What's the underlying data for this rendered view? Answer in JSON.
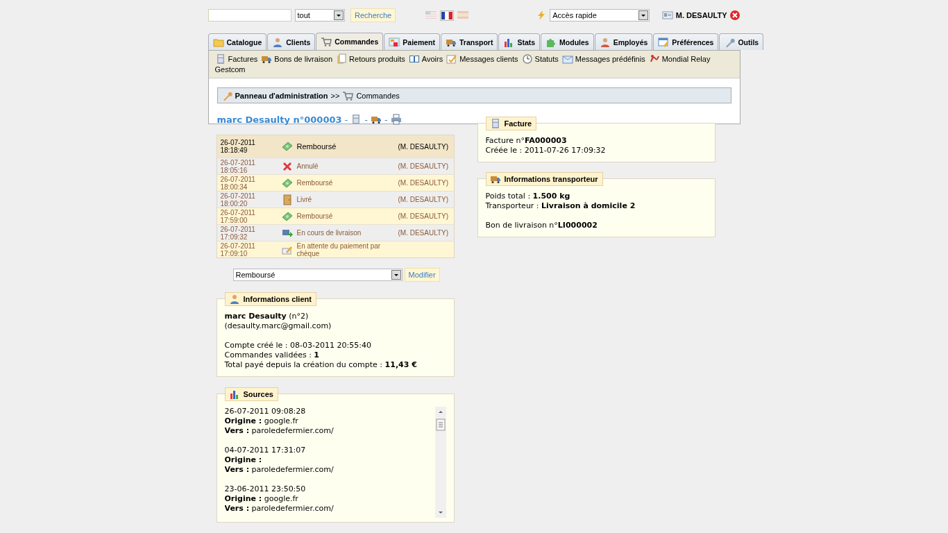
{
  "topbar": {
    "filter": {
      "value": "tout"
    },
    "search_button": "Recherche",
    "languages": [
      {
        "selected": false
      },
      {
        "selected": true
      },
      {
        "selected": false
      }
    ],
    "quick_access": {
      "value": "Accès rapide"
    },
    "user": "M. DESAULTY"
  },
  "tabs": [
    {
      "label": "Catalogue",
      "selected": false
    },
    {
      "label": "Clients",
      "selected": false
    },
    {
      "label": "Commandes",
      "selected": true
    },
    {
      "label": "Paiement",
      "selected": false
    },
    {
      "label": "Transport",
      "selected": false
    },
    {
      "label": "Stats",
      "selected": false
    },
    {
      "label": "Modules",
      "selected": false
    },
    {
      "label": "Employés",
      "selected": false
    },
    {
      "label": "Préférences",
      "selected": false
    },
    {
      "label": "Outils",
      "selected": false
    }
  ],
  "submenu": [
    "Factures",
    "Bons de livraison",
    "Retours produits",
    "Avoirs",
    "Messages clients",
    "Statuts",
    "Messages prédéfinis",
    "Mondial Relay",
    "Gestcom"
  ],
  "breadcrumb": {
    "root": "Panneau d'administration",
    "separator": ">>",
    "current": "Commandes"
  },
  "order": {
    "title": "marc Desaulty n°000003",
    "separators": [
      "-",
      "-",
      "-"
    ]
  },
  "history": [
    {
      "date": "26-07-2011",
      "time": "18:18:49",
      "status": "Remboursé",
      "kind": "refund",
      "employee": "(M. DESAULTY)",
      "selected": true
    },
    {
      "date": "26-07-2011",
      "time": "18:05:16",
      "status": "Annulé",
      "kind": "cancel",
      "employee": "(M. DESAULTY)",
      "selected": false
    },
    {
      "date": "26-07-2011",
      "time": "18:00:34",
      "status": "Remboursé",
      "kind": "refund",
      "employee": "(M. DESAULTY)",
      "selected": false
    },
    {
      "date": "26-07-2011",
      "time": "18:00:20",
      "status": "Livré",
      "kind": "delivered",
      "employee": "(M. DESAULTY)",
      "selected": false
    },
    {
      "date": "26-07-2011",
      "time": "17:59:00",
      "status": "Remboursé",
      "kind": "refund",
      "employee": "(M. DESAULTY)",
      "selected": false
    },
    {
      "date": "26-07-2011",
      "time": "17:09:32",
      "status": "En cours de livraison",
      "kind": "shipping",
      "employee": "(M. DESAULTY)",
      "selected": false
    },
    {
      "date": "26-07-2011",
      "time": "17:09:10",
      "status": "En attente du paiement par chèque",
      "kind": "waiting",
      "selected": false
    }
  ],
  "status_change": {
    "value": "Remboursé",
    "button": "Modifier"
  },
  "client": {
    "legend": "Informations client",
    "name": "**marc Desaulty** (n°2)",
    "email": "(desaulty.marc@gmail.com)",
    "lines": [
      "Compte créé le : 08-03-2011 20:55:40",
      "Commandes validées : **1**",
      "Total payé depuis la création du compte : **11,43 €**"
    ]
  },
  "sources": {
    "legend": "Sources",
    "entries": [
      {
        "date": "26-07-2011 09:08:28",
        "origin": "**Origine :** google.fr",
        "target": "**Vers :** paroledefermier.com/"
      },
      {
        "date": "04-07-2011 17:31:07",
        "origin": "**Origine :**",
        "target": "**Vers :** paroledefermier.com/"
      },
      {
        "date": "23-06-2011 23:50:50",
        "origin": "**Origine :** google.fr",
        "target": "**Vers :** paroledefermier.com/"
      }
    ]
  },
  "invoice": {
    "legend": "Facture",
    "lines": [
      "Facture n°**FA000003**",
      "Créée le : 2011-07-26 17:09:32"
    ]
  },
  "carrier": {
    "legend": "Informations transporteur",
    "lines": [
      "Poids total : **1.500 kg**",
      "Transporteur : **Livraison à domicile 2**"
    ],
    "delivery": "Bon de livraison n°**LI000002**"
  }
}
